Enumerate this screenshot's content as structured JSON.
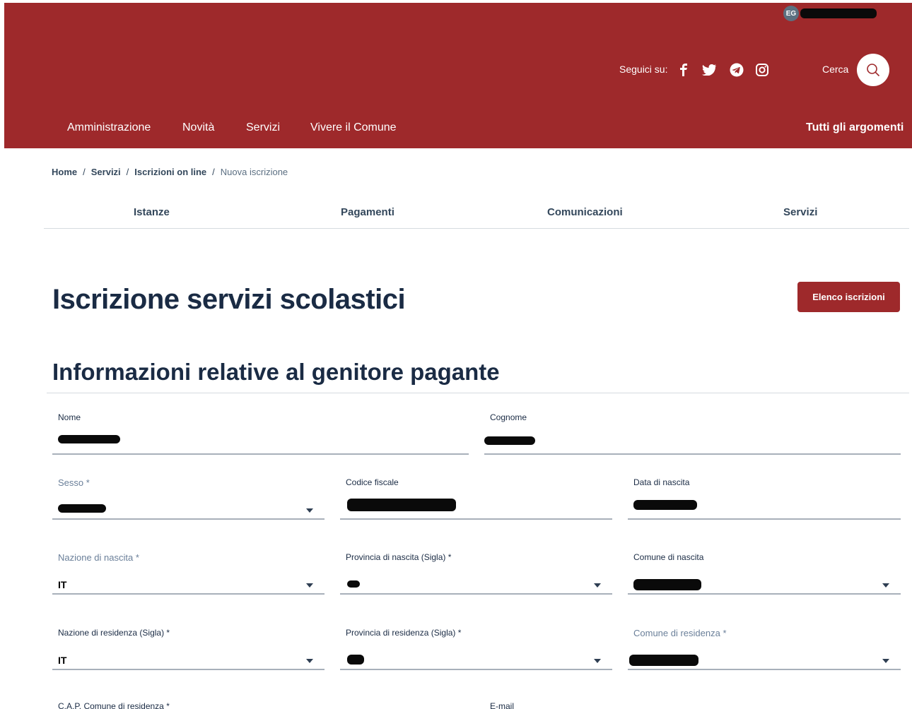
{
  "header": {
    "user_initials": "EG",
    "follow_label": "Seguici su:",
    "social": [
      "facebook-icon",
      "twitter-icon",
      "telegram-icon",
      "instagram-icon"
    ],
    "search_label": "Cerca",
    "nav": [
      "Amministrazione",
      "Novità",
      "Servizi",
      "Vivere il Comune"
    ],
    "all_topics": "Tutti gli argomenti"
  },
  "breadcrumb": [
    "Home",
    "Servizi",
    "Iscrizioni on line",
    "Nuova iscrizione"
  ],
  "tabs": [
    "Istanze",
    "Pagamenti",
    "Comunicazioni",
    "Servizi"
  ],
  "page": {
    "title": "Iscrizione servizi scolastici",
    "list_button": "Elenco iscrizioni",
    "section_title": "Informazioni relative al genitore pagante"
  },
  "form": {
    "nome": {
      "label": "Nome"
    },
    "cognome": {
      "label": "Cognome"
    },
    "sesso": {
      "label": "Sesso *"
    },
    "codice_fiscale": {
      "label": "Codice fiscale"
    },
    "data_nascita": {
      "label": "Data di nascita"
    },
    "nazione_nascita": {
      "label": "Nazione di nascita *",
      "value": "IT"
    },
    "provincia_nascita": {
      "label": "Provincia di nascita (Sigla) *"
    },
    "comune_nascita": {
      "label": "Comune di nascita"
    },
    "nazione_residenza": {
      "label": "Nazione di residenza (Sigla) *",
      "value": "IT"
    },
    "provincia_residenza": {
      "label": "Provincia di residenza (Sigla) *"
    },
    "comune_residenza": {
      "label": "Comune di residenza *"
    },
    "cap": {
      "label": "C.A.P. Comune di residenza *"
    },
    "email": {
      "label": "E-mail"
    }
  },
  "colors": {
    "brand": "#9e292b",
    "text": "#1a2b44"
  }
}
